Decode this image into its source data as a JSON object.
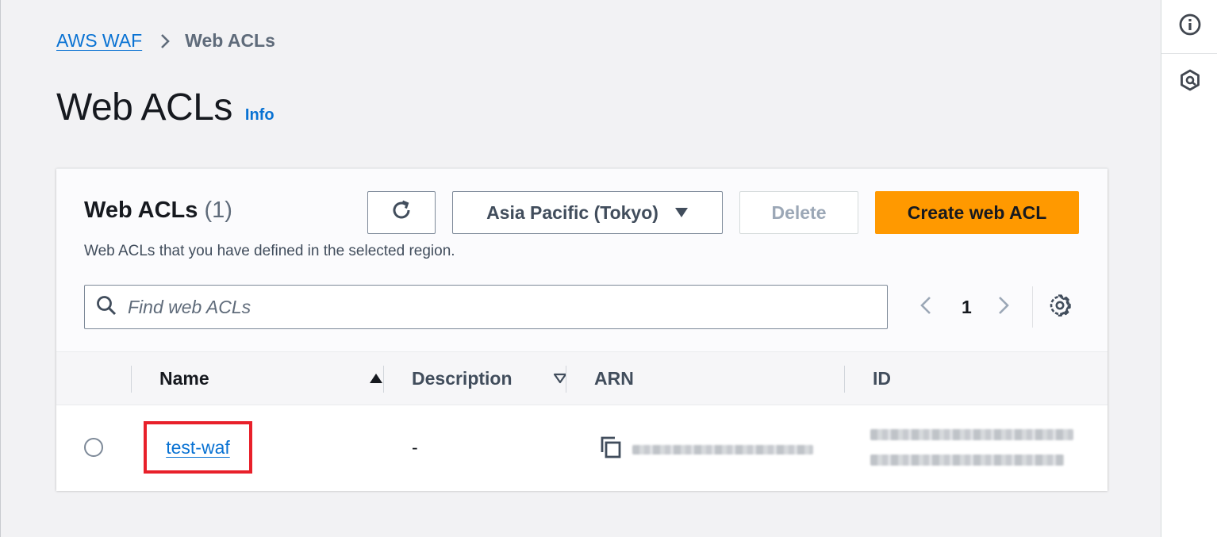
{
  "breadcrumb": {
    "root": "AWS WAF",
    "current": "Web ACLs"
  },
  "page": {
    "title": "Web ACLs",
    "info": "Info"
  },
  "panel": {
    "title": "Web ACLs",
    "count": "(1)",
    "description": "Web ACLs that you have defined in the selected region.",
    "region_label": "Asia Pacific (Tokyo)",
    "delete_label": "Delete",
    "create_label": "Create web ACL",
    "search_placeholder": "Find web ACLs",
    "current_page": "1"
  },
  "table": {
    "columns": [
      "Name",
      "Description",
      "ARN",
      "ID"
    ],
    "rows": [
      {
        "name": "test-waf",
        "description": "-",
        "arn": "[redacted]",
        "id": "[redacted]"
      }
    ]
  },
  "icons": {
    "refresh": "refresh-icon",
    "region_caret": "caret-down-icon",
    "search": "search-icon",
    "prev": "chevron-left-icon",
    "next": "chevron-right-icon",
    "settings": "gear-icon",
    "copy": "copy-icon",
    "info_panel": "info-circle-icon",
    "rail_second": "hexagon-icon"
  },
  "colors": {
    "link": "#0972d3",
    "primary_button": "#ff9900",
    "highlight_box": "#e8202a"
  }
}
